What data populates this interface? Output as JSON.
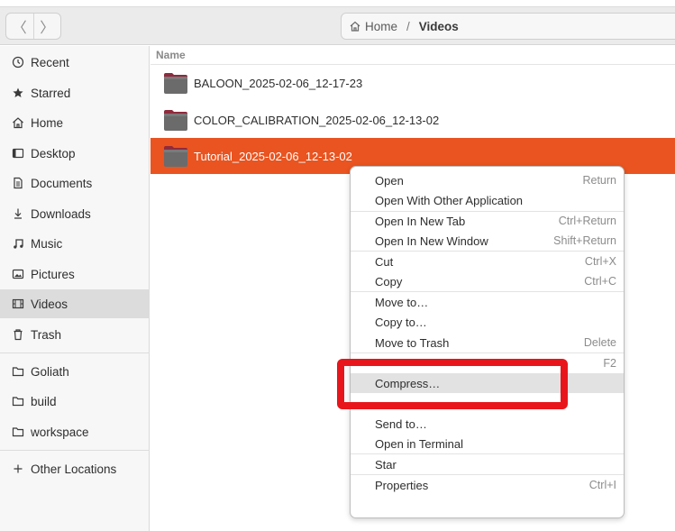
{
  "header": {
    "back_glyph": "〈",
    "forward_glyph": "〉",
    "breadcrumb": {
      "home": "Home",
      "separator": "/",
      "current": "Videos"
    }
  },
  "sidebar": {
    "items": [
      {
        "label": "Recent",
        "icon": "clock-icon"
      },
      {
        "label": "Starred",
        "icon": "star-icon"
      },
      {
        "label": "Home",
        "icon": "home-icon"
      },
      {
        "label": "Desktop",
        "icon": "desktop-icon"
      },
      {
        "label": "Documents",
        "icon": "document-icon"
      },
      {
        "label": "Downloads",
        "icon": "download-icon"
      },
      {
        "label": "Music",
        "icon": "music-icon"
      },
      {
        "label": "Pictures",
        "icon": "pictures-icon"
      },
      {
        "label": "Videos",
        "icon": "video-icon"
      },
      {
        "label": "Trash",
        "icon": "trash-icon"
      },
      {
        "label": "Goliath",
        "icon": "folder-icon"
      },
      {
        "label": "build",
        "icon": "folder-icon"
      },
      {
        "label": "workspace",
        "icon": "folder-icon"
      },
      {
        "label": "Other Locations",
        "icon": "plus-icon"
      }
    ]
  },
  "files": {
    "column_name": "Name",
    "rows": [
      {
        "name": "BALOON_2025-02-06_12-17-23"
      },
      {
        "name": "COLOR_CALIBRATION_2025-02-06_12-13-02"
      },
      {
        "name": "Tutorial_2025-02-06_12-13-02",
        "selected": true
      }
    ]
  },
  "context_menu": {
    "items": [
      {
        "label": "Open",
        "accel": "Return"
      },
      {
        "label": "Open With Other Application",
        "accel": ""
      },
      {
        "label": "Open In New Tab",
        "accel": "Ctrl+Return"
      },
      {
        "label": "Open In New Window",
        "accel": "Shift+Return"
      },
      {
        "label": "Cut",
        "accel": "Ctrl+X"
      },
      {
        "label": "Copy",
        "accel": "Ctrl+C"
      },
      {
        "label": "Move to…",
        "accel": ""
      },
      {
        "label": "Copy to…",
        "accel": ""
      },
      {
        "label": "Move to Trash",
        "accel": "Delete"
      },
      {
        "label": "",
        "accel": "F2"
      },
      {
        "label": "Compress…",
        "accel": ""
      },
      {
        "label": "Send to…",
        "accel": ""
      },
      {
        "label": "Open in Terminal",
        "accel": ""
      },
      {
        "label": "Star",
        "accel": ""
      },
      {
        "label": "Properties",
        "accel": "Ctrl+I"
      }
    ]
  },
  "colors": {
    "accent": "#e95420",
    "highlight_box": "#e8161b"
  }
}
